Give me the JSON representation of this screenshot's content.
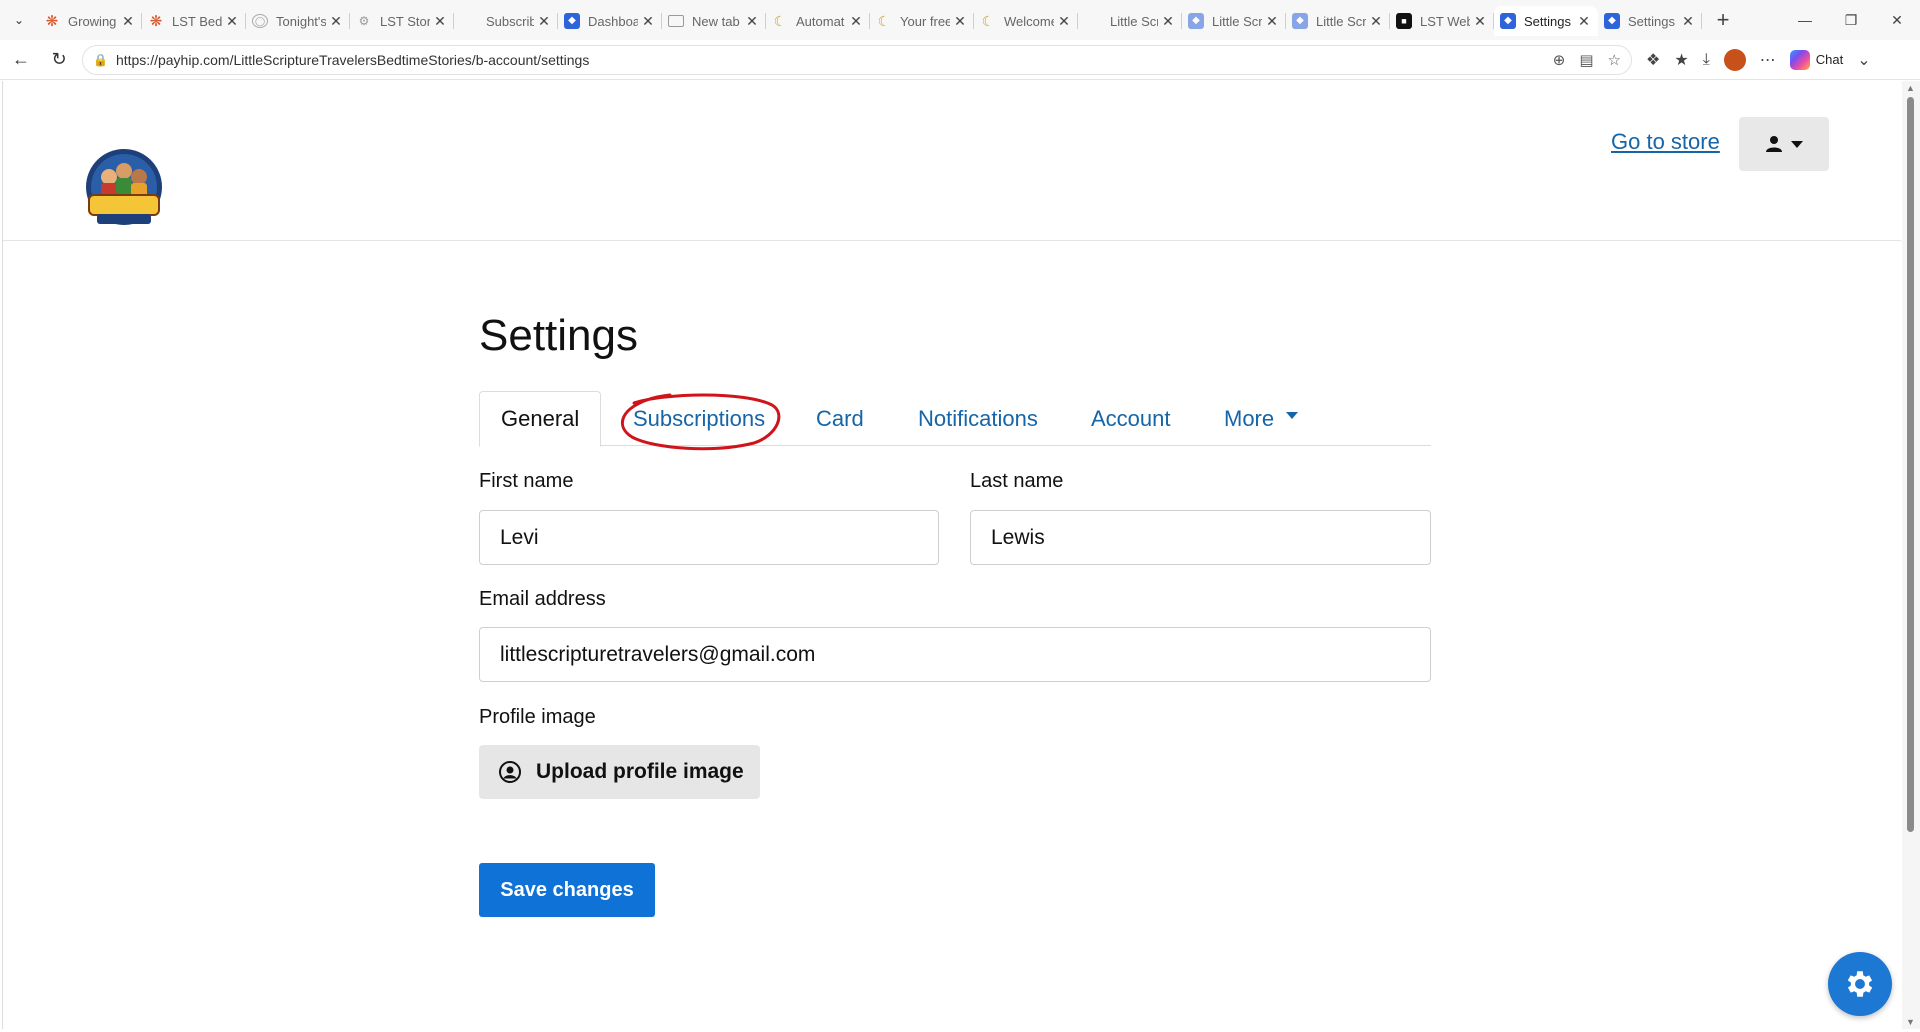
{
  "browser": {
    "tabs": [
      {
        "title": "Growing",
        "favicon": "asterisk-icon"
      },
      {
        "title": "LST Bedt",
        "favicon": "asterisk-icon"
      },
      {
        "title": "Tonight's",
        "favicon": "globe-icon"
      },
      {
        "title": "LST Story",
        "favicon": "gear-icon"
      },
      {
        "title": "Subscrib",
        "favicon": "none"
      },
      {
        "title": "Dashboa",
        "favicon": "shield-icon"
      },
      {
        "title": "New tab",
        "favicon": "newtab-icon"
      },
      {
        "title": "Automat",
        "favicon": "moon-icon"
      },
      {
        "title": "Your free",
        "favicon": "moon-icon"
      },
      {
        "title": "Welcome",
        "favicon": "moon-icon"
      },
      {
        "title": "Little Scr",
        "favicon": "none"
      },
      {
        "title": "Little Scr",
        "favicon": "shield-icon"
      },
      {
        "title": "Little Scr",
        "favicon": "shield-icon"
      },
      {
        "title": "LST Web",
        "favicon": "black-icon"
      },
      {
        "title": "Settings",
        "favicon": "shield-icon",
        "active": true
      },
      {
        "title": "Settings",
        "favicon": "shield-icon"
      }
    ],
    "url": "https://payhip.com/LittleScriptureTravelersBedtimeStories/b-account/settings",
    "chat_label": "Chat"
  },
  "header": {
    "go_to_store": "Go to store"
  },
  "settings": {
    "title": "Settings",
    "tabs": [
      "General",
      "Subscriptions",
      "Card",
      "Notifications",
      "Account",
      "More"
    ],
    "active_tab": "General",
    "first_name_label": "First name",
    "first_name_value": "Levi",
    "last_name_label": "Last name",
    "last_name_value": "Lewis",
    "email_label": "Email address",
    "email_value": "littlescripturetravelers@gmail.com",
    "profile_image_label": "Profile image",
    "upload_button": "Upload profile image",
    "save_button": "Save changes"
  },
  "colors": {
    "link": "#1565a8",
    "primary_button": "#0f72d6",
    "annotation": "#d0141b"
  }
}
